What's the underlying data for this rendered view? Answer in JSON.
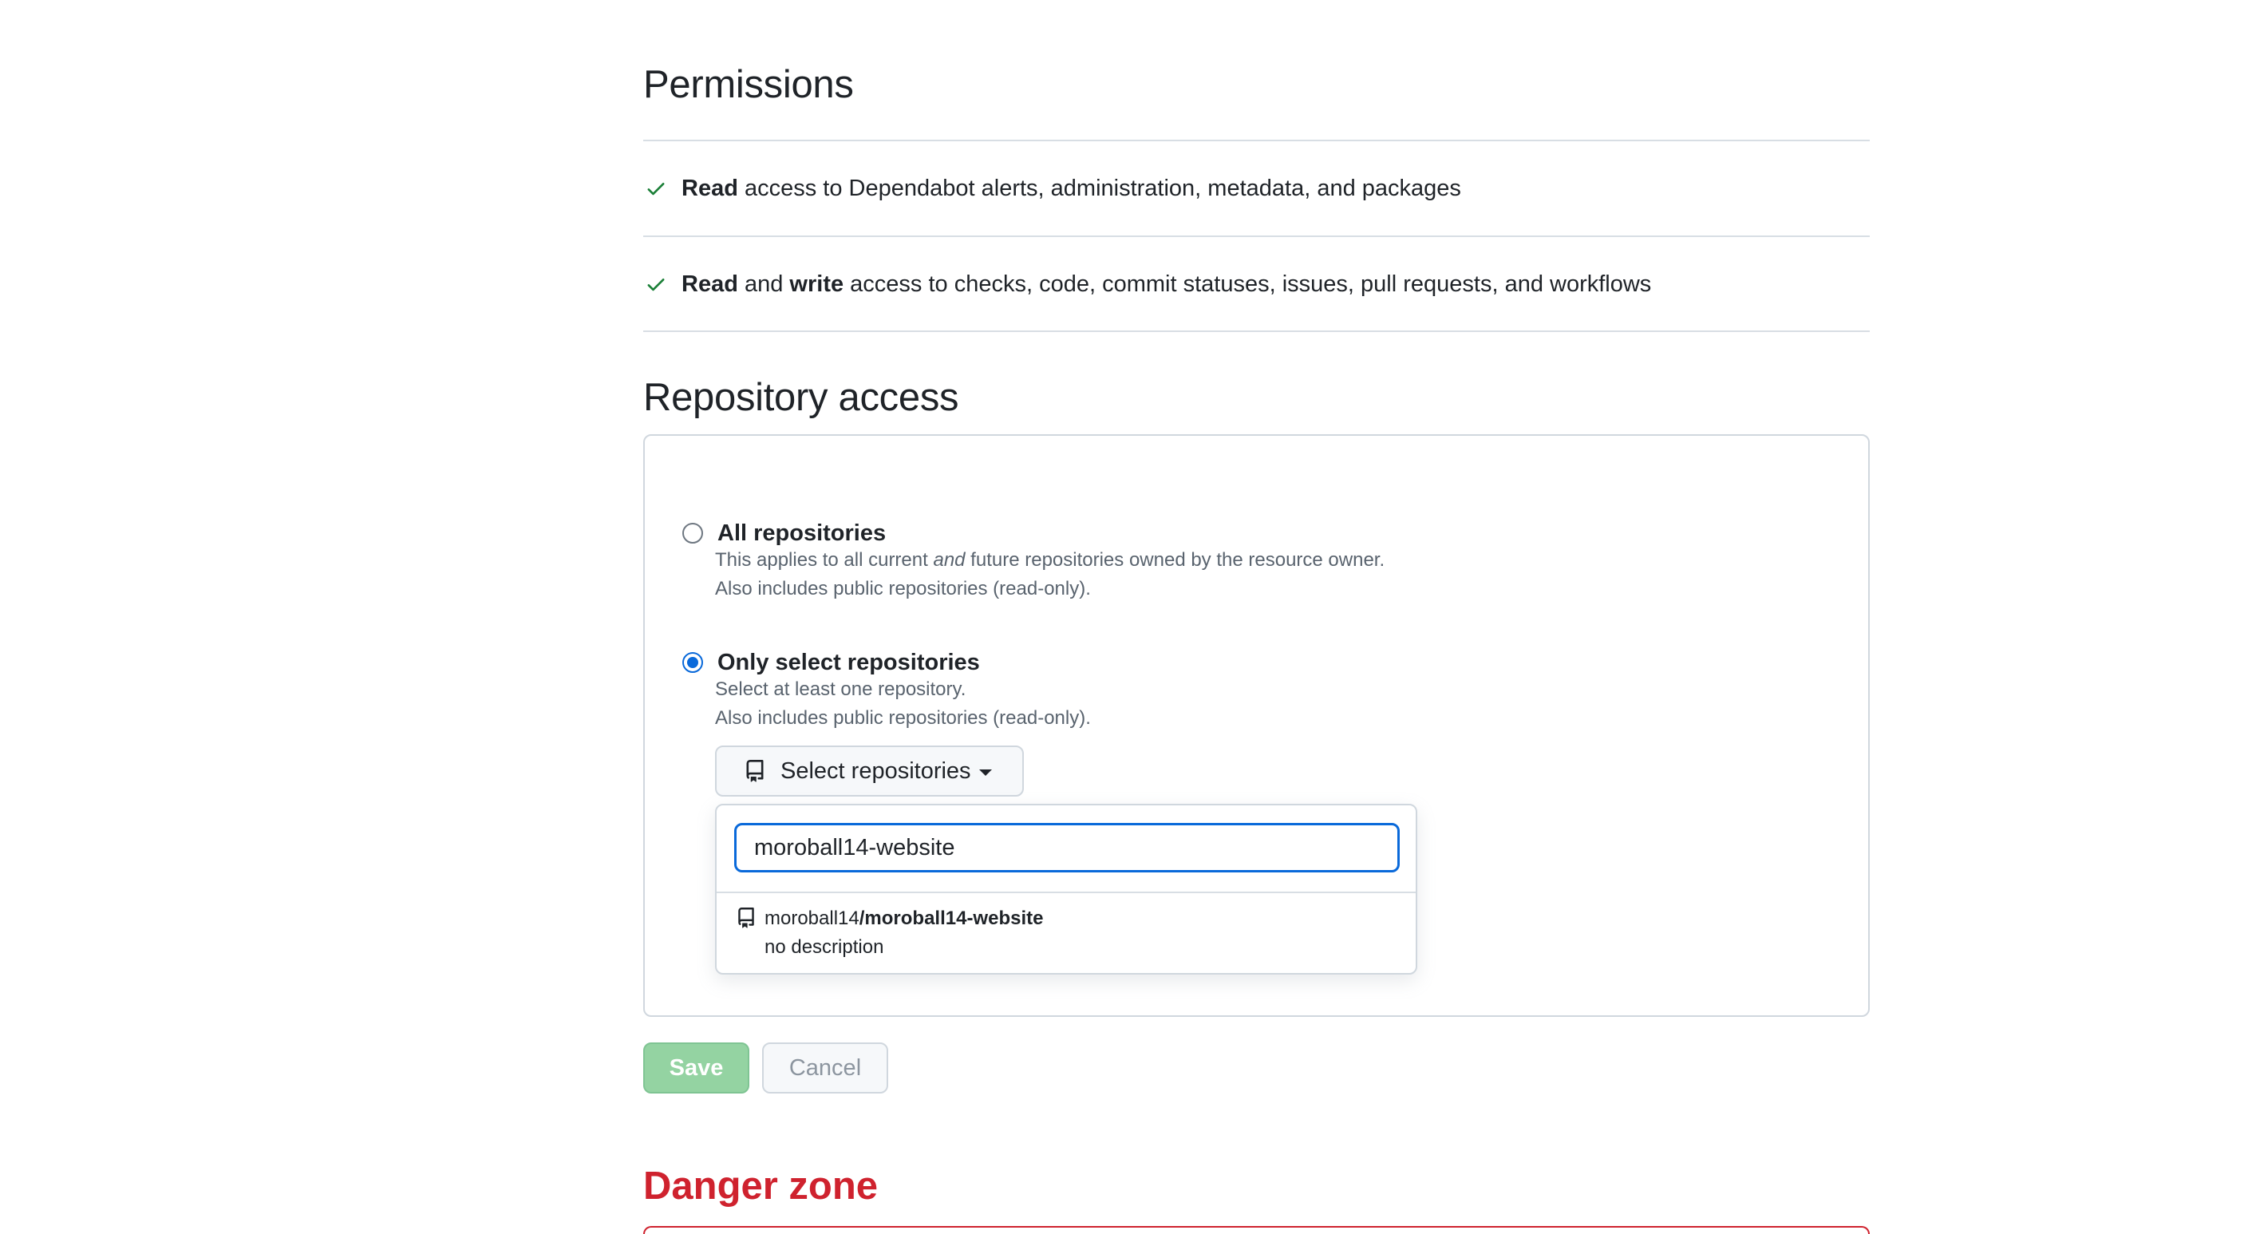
{
  "permissions": {
    "title": "Permissions",
    "rows": [
      {
        "strong1": "Read",
        "text": " access to Dependabot alerts, administration, metadata, and packages"
      },
      {
        "strong1": "Read",
        "mid": " and ",
        "strong2": "write",
        "text": " access to checks, code, commit statuses, issues, pull requests, and workflows"
      }
    ]
  },
  "repository_access": {
    "title": "Repository access",
    "all": {
      "label": "All repositories",
      "desc_part1": "This applies to all current ",
      "desc_em": "and",
      "desc_part2": " future repositories owned by the resource owner.",
      "desc_line2": "Also includes public repositories (read-only).",
      "checked": false
    },
    "select": {
      "label": "Only select repositories",
      "desc_line1": "Select at least one repository.",
      "desc_line2": "Also includes public repositories (read-only).",
      "checked": true
    },
    "select_button_label": "Select repositories",
    "search_value": "moroball14-website",
    "results": [
      {
        "owner": "moroball14",
        "repo": "/moroball14-website",
        "description": "no description"
      }
    ]
  },
  "actions": {
    "save_label": "Save",
    "cancel_label": "Cancel"
  },
  "danger": {
    "title": "Danger zone"
  },
  "colors": {
    "accent": "#0969da",
    "success": "#1a7f37",
    "danger": "#cf222e",
    "save_disabled": "#94d3a2"
  }
}
